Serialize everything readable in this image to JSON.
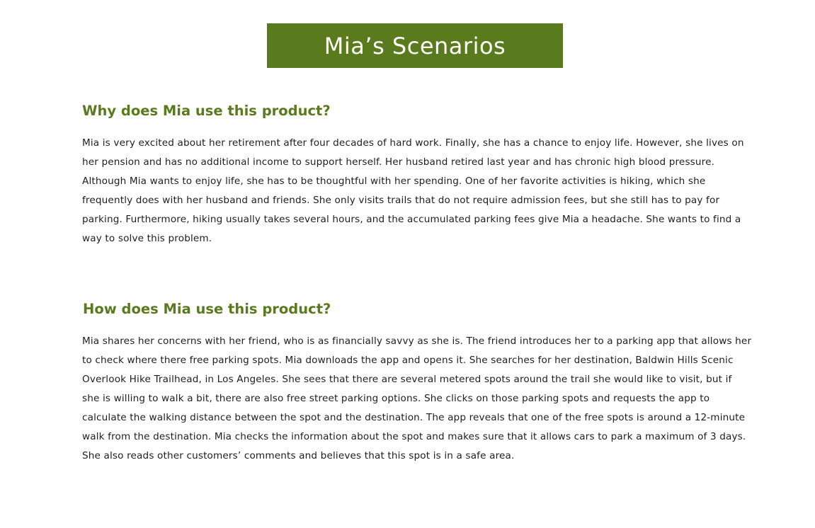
{
  "title": "Mia’s Scenarios",
  "colors": {
    "accent": "#5a7a1e",
    "body_text": "#1e1e1e",
    "background": "#ffffff"
  },
  "sections": [
    {
      "heading": "Why does Mia use this product?",
      "body": "Mia is very excited about her retirement after four decades of hard work. Finally, she has a chance to enjoy life. However, she lives on her pension and has no additional income to support herself. Her husband retired last year and has chronic high blood pressure. Although Mia wants to enjoy life, she has to be thoughtful with her spending. One of her favorite activities is hiking, which she frequently does with her husband and friends. She only visits trails that do not require admission fees, but she still has to pay for parking. Furthermore, hiking usually takes several hours, and the accumulated parking fees give Mia a headache. She wants to find a way to solve this problem."
    },
    {
      "heading": "How does Mia use this product?",
      "body": "Mia shares her concerns with her friend, who is as financially savvy as she is. The friend introduces her to a parking app that allows her to check where there free parking spots. Mia downloads the app and opens it. She searches for her destination, Baldwin Hills Scenic Overlook Hike Trailhead, in Los Angeles. She sees that there are several metered spots around the trail she would like to visit, but if she is willing to walk a bit, there are also free street parking options. She clicks on those parking spots and requests the app to calculate the walking distance between the spot and the destination. The app reveals that one of the free spots is around a 12-minute walk from the destination. Mia checks the information about the spot and makes sure that it allows cars to park a maximum of 3 days. She also reads other customers’ comments and believes that this spot is in a safe area."
    }
  ]
}
